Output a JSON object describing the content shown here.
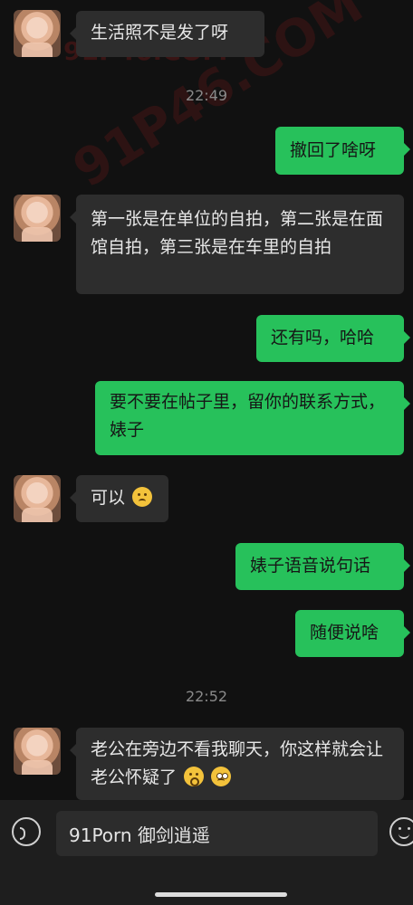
{
  "watermarks": [
    "91P46.COM",
    "91P46.COM"
  ],
  "times": [
    "22:49",
    "22:52"
  ],
  "messages": [
    {
      "side": "in",
      "text": "生活照不是发了呀"
    },
    {
      "side": "out",
      "text": "撤回了啥呀"
    },
    {
      "side": "in",
      "text": "第一张是在单位的自拍，第二张是在面馆自拍，第三张是在车里的自拍"
    },
    {
      "side": "out",
      "text": "还有吗，哈哈"
    },
    {
      "side": "out",
      "text": "要不要在帖子里，留你的联系方式，婊子"
    },
    {
      "side": "in",
      "text": "可以",
      "emoji": "sweat-smile"
    },
    {
      "side": "out",
      "text": "婊子语音说句话"
    },
    {
      "side": "out",
      "text": "随便说啥"
    },
    {
      "side": "in",
      "text": "老公在旁边不看我聊天，你这样就会让老公怀疑了",
      "emojis": [
        "thinking",
        "eyes"
      ]
    }
  ],
  "input": {
    "value": "91Porn 御剑逍遥"
  },
  "icons": {
    "voice": "voice-icon",
    "emoji": "emoji-icon"
  }
}
